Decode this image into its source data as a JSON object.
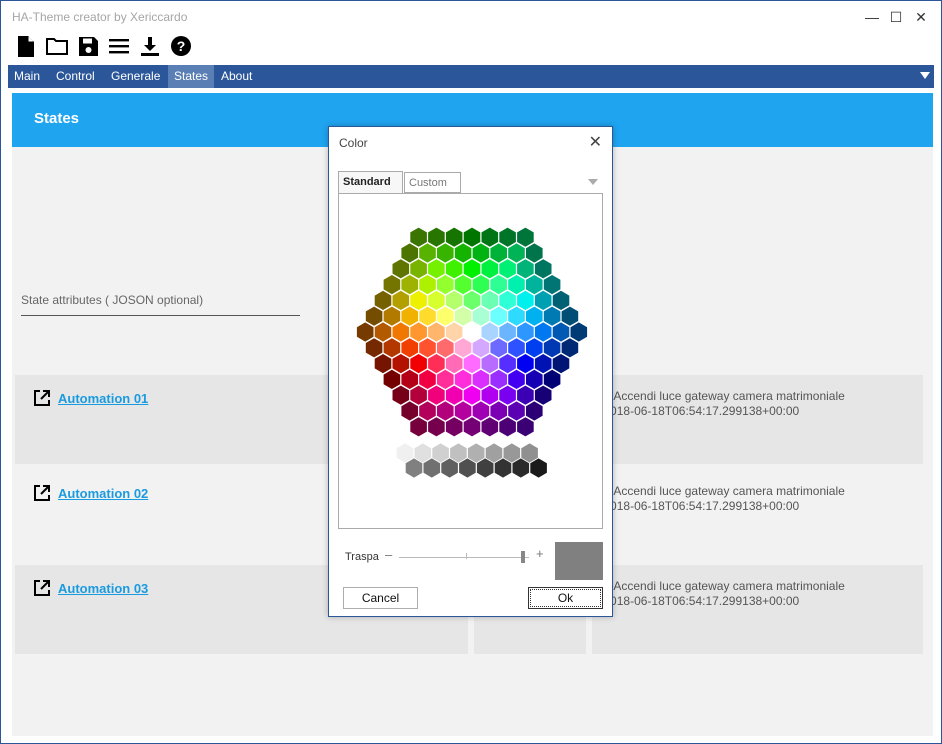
{
  "window": {
    "title": "HA-Theme creator by Xericcardo"
  },
  "toolbar": {
    "icons": [
      "new-file-icon",
      "open-folder-icon",
      "save-icon",
      "menu-icon",
      "download-icon",
      "help-icon"
    ]
  },
  "menu": {
    "items": [
      {
        "label": "Main"
      },
      {
        "label": "Control"
      },
      {
        "label": "Generale"
      },
      {
        "label": "States"
      },
      {
        "label": "About"
      }
    ],
    "active": "States"
  },
  "page": {
    "header_title": "States",
    "attr_placeholder": "State attributes ( JOSON optional)"
  },
  "automations": [
    {
      "name": "Automation 01",
      "line1": "friendly_name: Accendi luce gateway camera matrimoniale",
      "line2": "last_triggered: 2018-06-18T06:54:17.299138+00:00"
    },
    {
      "name": "Automation 02",
      "line1": "friendly_name: Accendi luce gateway camera matrimoniale",
      "line2": "last_triggered: 2018-06-18T06:54:17.299138+00:00"
    },
    {
      "name": "Automation 03",
      "line1": "friendly_name: Accendi luce gateway camera matrimoniale",
      "line2": "last_triggered: 2018-06-18T06:54:17.299138+00:00"
    }
  ],
  "dialog": {
    "title": "Color",
    "tabs": [
      {
        "label": "Standard"
      },
      {
        "label": "Custom"
      }
    ],
    "active_tab": "Standard",
    "transparency_label": "Traspa",
    "transparency_value": 0.95,
    "preview_color": "#808080",
    "cancel_label": "Cancel",
    "ok_label": "Ok"
  },
  "colors": {
    "menubar": "#2b579a",
    "header": "#1fa4f0",
    "link": "#1a9be0"
  }
}
